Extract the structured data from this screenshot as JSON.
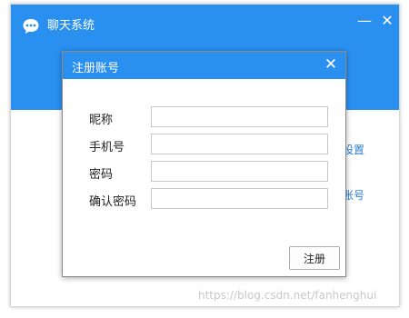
{
  "main_window": {
    "title": "聊天系统",
    "minimize_label": "—",
    "close_label": "✕",
    "links": {
      "network_settings": "络设置",
      "register_account": "册账号"
    }
  },
  "register_dialog": {
    "title": "注册账号",
    "close_label": "✕",
    "fields": [
      {
        "label": "昵称",
        "value": "",
        "placeholder": ""
      },
      {
        "label": "手机号",
        "value": "",
        "placeholder": ""
      },
      {
        "label": "密码",
        "value": "",
        "placeholder": ""
      },
      {
        "label": "确认密码",
        "value": "",
        "placeholder": ""
      }
    ],
    "submit_label": "注册"
  },
  "watermark": "https://blog.csdn.net/fanhenghui",
  "colors": {
    "accent": "#2a90f0",
    "link": "#2a7fd4"
  }
}
